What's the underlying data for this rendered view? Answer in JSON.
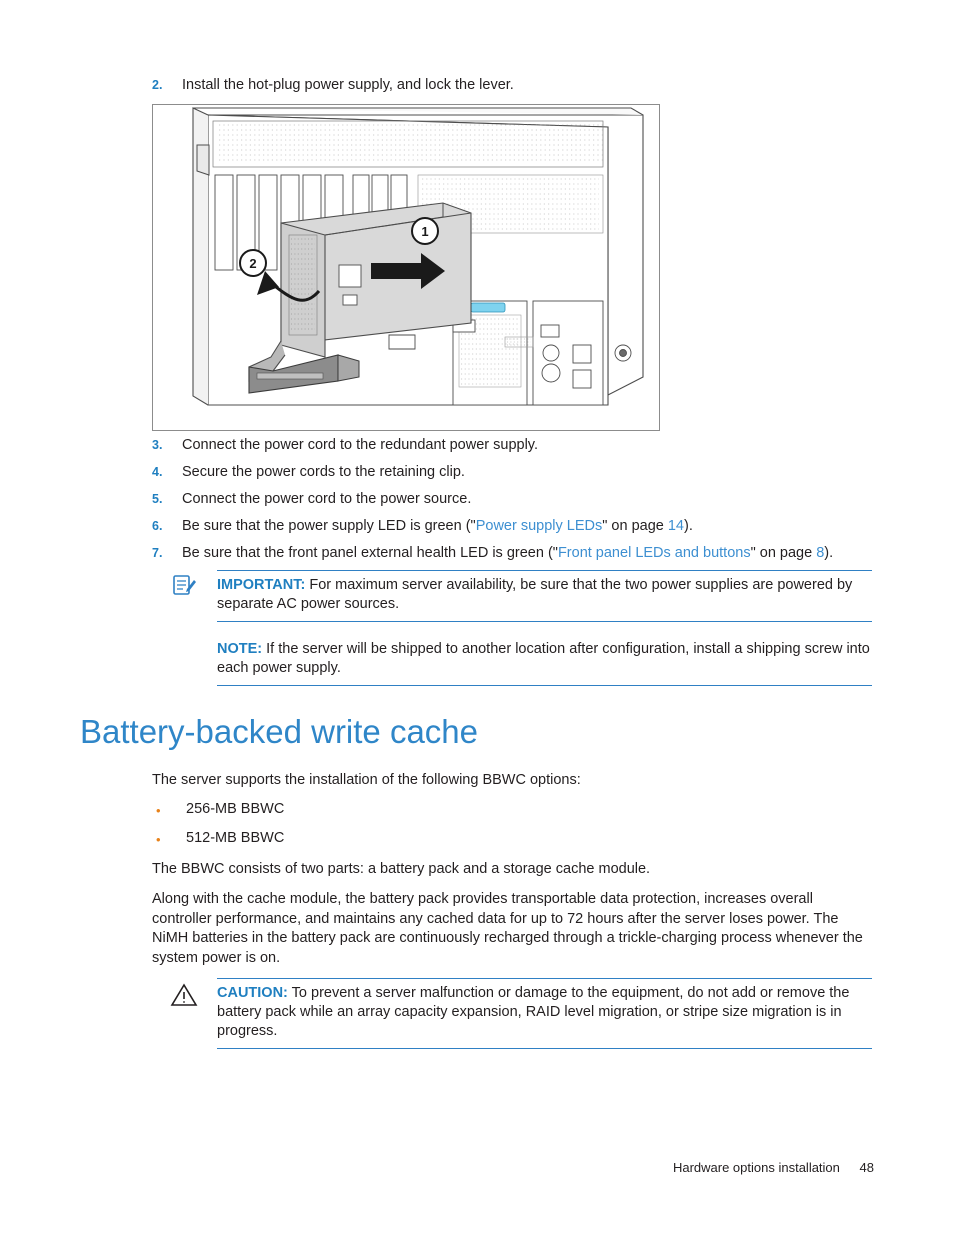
{
  "steps": [
    {
      "num": "2.",
      "text": "Install the hot-plug power supply, and lock the lever."
    },
    {
      "num": "3.",
      "text": "Connect the power cord to the redundant power supply."
    },
    {
      "num": "4.",
      "text": "Secure the power cords to the retaining clip."
    },
    {
      "num": "5.",
      "text": "Connect the power cord to the power source."
    }
  ],
  "step6": {
    "num": "6.",
    "pre": "Be sure that the power supply LED is green (\"",
    "link": "Power supply LEDs",
    "mid": "\" on page ",
    "page": "14",
    "post": ")."
  },
  "step7": {
    "num": "7.",
    "pre": "Be sure that the front panel external health LED is green (\"",
    "link": "Front panel LEDs and buttons",
    "mid": "\" on page ",
    "page": "8",
    "post": ")."
  },
  "figure": {
    "callout_1": "1",
    "callout_2": "2",
    "name": "hot-plug-power-supply-installation-illustration"
  },
  "important": {
    "label": "IMPORTANT:",
    "text": "For maximum server availability, be sure that the two power supplies are powered by separate AC power sources.",
    "icon": "note-pencil-icon"
  },
  "note": {
    "label": "NOTE:",
    "text": "If the server will be shipped to another location after configuration, install a shipping screw into each power supply."
  },
  "heading": "Battery-backed write cache",
  "intro": "The server supports the installation of the following BBWC options:",
  "bullets": [
    {
      "dot": "•",
      "label": "256-MB BBWC"
    },
    {
      "dot": "•",
      "label": "512-MB BBWC"
    }
  ],
  "para1": "The BBWC consists of two parts: a battery pack and a storage cache module.",
  "para2": "Along with the cache module, the battery pack provides transportable data protection, increases overall controller performance, and maintains any cached data for up to 72 hours after the server loses power. The NiMH batteries in the battery pack are continuously recharged through a trickle-charging process whenever the system power is on.",
  "caution": {
    "label": "CAUTION:",
    "text": "To prevent a server malfunction or damage to the equipment, do not add or remove the battery pack while an array capacity expansion, RAID level migration, or stripe size migration is in progress.",
    "icon": "warning-triangle-icon"
  },
  "footer": {
    "chapter": "Hardware options installation",
    "page": "48"
  },
  "colors": {
    "accent_blue": "#1f7fc0",
    "heading_blue": "#2f86c8",
    "link_blue": "#3d8fd1",
    "bullet_orange": "#e8821a",
    "text": "#231f20",
    "rule": "#2f80c4"
  }
}
